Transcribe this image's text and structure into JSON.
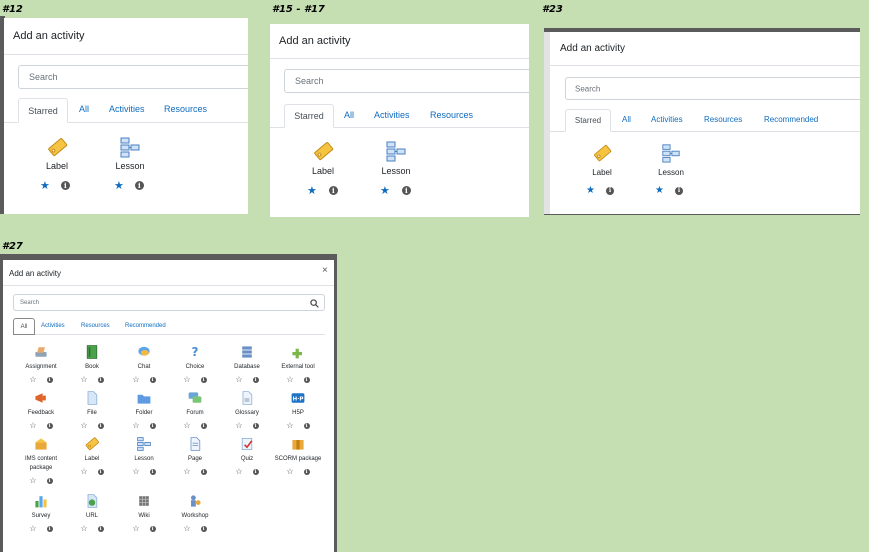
{
  "captions": {
    "p12": "#12",
    "p15": "#15 - #17",
    "p23": "#23",
    "p27": "#27"
  },
  "dialog": {
    "title": "Add an activity",
    "search_placeholder": "Search",
    "close": "×"
  },
  "tabs": {
    "starred": "Starred",
    "all": "All",
    "activities": "Activities",
    "resources": "Resources",
    "recommended": "Recommended"
  },
  "starred_items": [
    {
      "label": "Label",
      "icon": "label-icon"
    },
    {
      "label": "Lesson",
      "icon": "lesson-icon"
    }
  ],
  "all_items": [
    {
      "label": "Assignment",
      "icon": "assignment-icon"
    },
    {
      "label": "Book",
      "icon": "book-icon"
    },
    {
      "label": "Chat",
      "icon": "chat-icon"
    },
    {
      "label": "Choice",
      "icon": "choice-icon"
    },
    {
      "label": "Database",
      "icon": "database-icon"
    },
    {
      "label": "External tool",
      "icon": "external-tool-icon"
    },
    {
      "label": "Feedback",
      "icon": "feedback-icon"
    },
    {
      "label": "File",
      "icon": "file-icon"
    },
    {
      "label": "Folder",
      "icon": "folder-icon"
    },
    {
      "label": "Forum",
      "icon": "forum-icon"
    },
    {
      "label": "Glossary",
      "icon": "glossary-icon"
    },
    {
      "label": "H5P",
      "icon": "h5p-icon"
    },
    {
      "label": "IMS content package",
      "icon": "ims-content-package-icon"
    },
    {
      "label": "Label",
      "icon": "label-icon"
    },
    {
      "label": "Lesson",
      "icon": "lesson-icon"
    },
    {
      "label": "Page",
      "icon": "page-icon"
    },
    {
      "label": "Quiz",
      "icon": "quiz-icon"
    },
    {
      "label": "SCORM package",
      "icon": "scorm-package-icon"
    },
    {
      "label": "Survey",
      "icon": "survey-icon"
    },
    {
      "label": "URL",
      "icon": "url-icon"
    },
    {
      "label": "Wiki",
      "icon": "wiki-icon"
    },
    {
      "label": "Workshop",
      "icon": "workshop-icon"
    }
  ],
  "info_glyph": "i",
  "colors": {
    "accent": "#0f6cbf",
    "background": "#c5dfb2"
  }
}
